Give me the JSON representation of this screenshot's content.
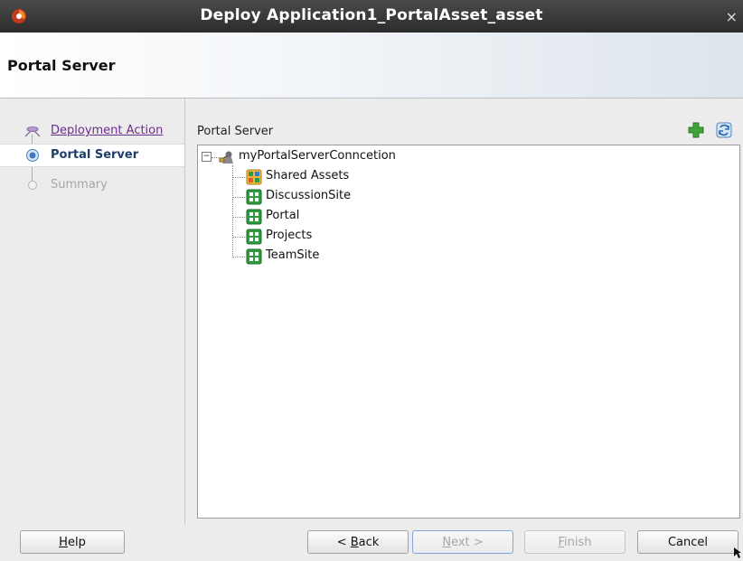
{
  "window": {
    "title": "Deploy Application1_PortalAsset_asset",
    "close_glyph": "×"
  },
  "header": {
    "title": "Portal Server"
  },
  "nav": {
    "steps": [
      {
        "label": "Deployment Action",
        "state": "completed-link"
      },
      {
        "label": "Portal Server",
        "state": "current"
      },
      {
        "label": "Summary",
        "state": "pending"
      }
    ]
  },
  "main": {
    "label": "Portal Server",
    "toolbar": {
      "add_icon": "add-icon",
      "refresh_icon": "refresh-icon"
    },
    "tree": {
      "root": {
        "label": "myPortalServerConncetion",
        "icon": "server-connection-icon",
        "expanded": true,
        "expander": "−"
      },
      "children": [
        {
          "label": "Shared Assets",
          "icon": "shared-assets-icon"
        },
        {
          "label": "DiscussionSite",
          "icon": "portal-site-icon"
        },
        {
          "label": "Portal",
          "icon": "portal-site-icon"
        },
        {
          "label": "Projects",
          "icon": "portal-site-icon"
        },
        {
          "label": "TeamSite",
          "icon": "portal-site-icon"
        }
      ]
    }
  },
  "buttons": {
    "help": {
      "mnemonic": "H",
      "rest": "elp"
    },
    "back": {
      "prefix": "< ",
      "mnemonic": "B",
      "rest": "ack"
    },
    "next": {
      "mnemonic": "N",
      "rest": "ext >"
    },
    "finish": {
      "mnemonic": "F",
      "rest": "inish"
    },
    "cancel": {
      "label": "Cancel"
    }
  },
  "colors": {
    "link_purple": "#6b2d8a",
    "current_step": "#1d3d6b",
    "icon_green": "#2e9b3e"
  }
}
